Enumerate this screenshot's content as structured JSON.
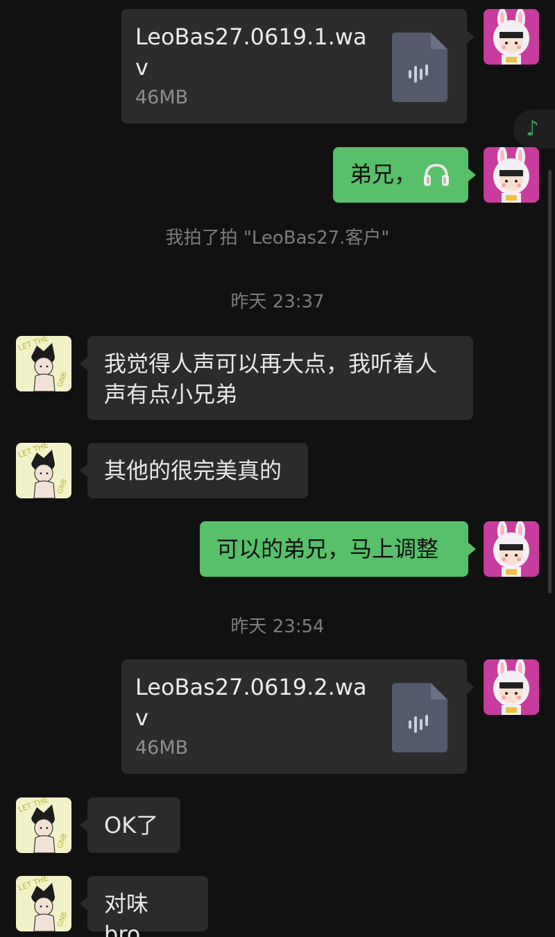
{
  "messages": {
    "file1": {
      "name": "LeoBas27.0619.1.wav",
      "size": "46MB"
    },
    "text_bro": "弟兄，",
    "pat_notice": "我拍了拍 \"LeoBas27.客户\"",
    "time1": "昨天 23:37",
    "reply1": "我觉得人声可以再大点，我听着人声有点小兄弟",
    "reply2": "其他的很完美真的",
    "self_reply": "可以的弟兄，马上调整",
    "time2": "昨天 23:54",
    "file2": {
      "name": "LeoBas27.0619.2.wav",
      "size": "46MB"
    },
    "reply3": "OK了",
    "reply4": "对味 bro"
  },
  "colors": {
    "background": "#111111",
    "self_bubble": "#58bf6a",
    "other_bubble": "#2b2b2b",
    "system_text": "#7c7c7c"
  },
  "icons": {
    "headphones": "headphones-emoji",
    "audio_file": "audio-file-icon",
    "music": "music-note-icon"
  }
}
